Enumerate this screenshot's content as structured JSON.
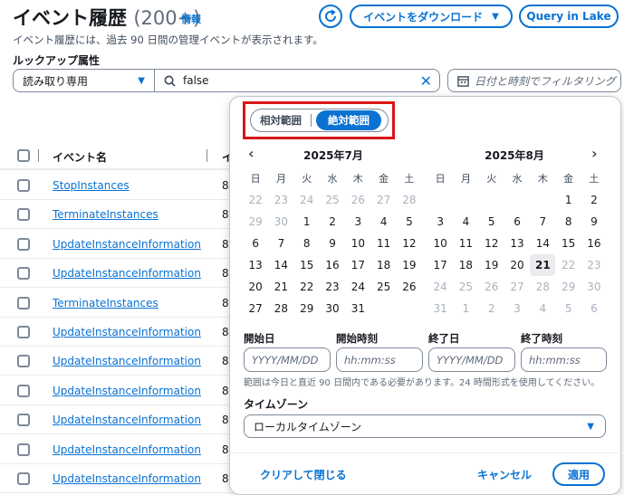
{
  "header": {
    "title": "イベント履歴",
    "count": "(200+)",
    "info_link": "情報",
    "download_label": "イベントをダウンロード",
    "query_label": "Query in Lake",
    "subtitle": "イベント履歴には、過去 90 日間の管理イベントが表示されます。"
  },
  "filter": {
    "lookup_label": "ルックアップ属性",
    "attribute_value": "読み取り専用",
    "search_value": "false",
    "date_placeholder": "日付と時刻でフィルタリング"
  },
  "table": {
    "header_name": "イベント名",
    "header_extra": "イ",
    "rows": [
      {
        "name": "StopInstances",
        "val": "8"
      },
      {
        "name": "TerminateInstances",
        "val": "8"
      },
      {
        "name": "UpdateInstanceInformation",
        "val": "8"
      },
      {
        "name": "UpdateInstanceInformation",
        "val": "8"
      },
      {
        "name": "TerminateInstances",
        "val": "8"
      },
      {
        "name": "UpdateInstanceInformation",
        "val": "8"
      },
      {
        "name": "UpdateInstanceInformation",
        "val": "8"
      },
      {
        "name": "UpdateInstanceInformation",
        "val": "8"
      },
      {
        "name": "UpdateInstanceInformation",
        "val": "8"
      },
      {
        "name": "UpdateInstanceInformation",
        "val": "8"
      },
      {
        "name": "UpdateInstanceInformation",
        "val": "8"
      }
    ]
  },
  "popover": {
    "relative_label": "相対範囲",
    "absolute_label": "絶対範囲",
    "weekdays": [
      "日",
      "月",
      "火",
      "水",
      "木",
      "金",
      "土"
    ],
    "left_month": {
      "title": "2025年7月",
      "days": [
        {
          "d": "22",
          "dim": true
        },
        {
          "d": "23",
          "dim": true
        },
        {
          "d": "24",
          "dim": true
        },
        {
          "d": "25",
          "dim": true
        },
        {
          "d": "26",
          "dim": true
        },
        {
          "d": "27",
          "dim": true
        },
        {
          "d": "28",
          "dim": true
        },
        {
          "d": "29",
          "dim": true
        },
        {
          "d": "30",
          "dim": true
        },
        {
          "d": "1"
        },
        {
          "d": "2"
        },
        {
          "d": "3"
        },
        {
          "d": "4"
        },
        {
          "d": "5"
        },
        {
          "d": "6"
        },
        {
          "d": "7"
        },
        {
          "d": "8"
        },
        {
          "d": "9"
        },
        {
          "d": "10"
        },
        {
          "d": "11"
        },
        {
          "d": "12"
        },
        {
          "d": "13"
        },
        {
          "d": "14"
        },
        {
          "d": "15"
        },
        {
          "d": "16"
        },
        {
          "d": "17"
        },
        {
          "d": "18"
        },
        {
          "d": "19"
        },
        {
          "d": "20"
        },
        {
          "d": "21"
        },
        {
          "d": "22"
        },
        {
          "d": "23"
        },
        {
          "d": "24"
        },
        {
          "d": "25"
        },
        {
          "d": "26"
        },
        {
          "d": "27"
        },
        {
          "d": "28"
        },
        {
          "d": "29"
        },
        {
          "d": "30"
        },
        {
          "d": "31"
        },
        {
          "d": ""
        },
        {
          "d": ""
        }
      ]
    },
    "right_month": {
      "title": "2025年8月",
      "days": [
        {
          "d": ""
        },
        {
          "d": ""
        },
        {
          "d": ""
        },
        {
          "d": ""
        },
        {
          "d": ""
        },
        {
          "d": "1"
        },
        {
          "d": "2"
        },
        {
          "d": "3"
        },
        {
          "d": "4"
        },
        {
          "d": "5"
        },
        {
          "d": "6"
        },
        {
          "d": "7"
        },
        {
          "d": "8"
        },
        {
          "d": "9"
        },
        {
          "d": "10"
        },
        {
          "d": "11"
        },
        {
          "d": "12"
        },
        {
          "d": "13"
        },
        {
          "d": "14"
        },
        {
          "d": "15"
        },
        {
          "d": "16"
        },
        {
          "d": "17"
        },
        {
          "d": "18"
        },
        {
          "d": "19"
        },
        {
          "d": "20"
        },
        {
          "d": "21",
          "today": true
        },
        {
          "d": "22",
          "dim": true
        },
        {
          "d": "23",
          "dim": true
        },
        {
          "d": "24",
          "dim": true
        },
        {
          "d": "25",
          "dim": true
        },
        {
          "d": "26",
          "dim": true
        },
        {
          "d": "27",
          "dim": true
        },
        {
          "d": "28",
          "dim": true
        },
        {
          "d": "29",
          "dim": true
        },
        {
          "d": "30",
          "dim": true
        },
        {
          "d": "31",
          "dim": true
        },
        {
          "d": "1",
          "dim": true
        },
        {
          "d": "2",
          "dim": true
        },
        {
          "d": "3",
          "dim": true
        },
        {
          "d": "4",
          "dim": true
        },
        {
          "d": "5",
          "dim": true
        },
        {
          "d": "6",
          "dim": true
        }
      ]
    },
    "start_date_label": "開始日",
    "start_time_label": "開始時刻",
    "end_date_label": "終了日",
    "end_time_label": "終了時刻",
    "date_placeholder": "YYYY/MM/DD",
    "time_placeholder": "hh:mm:ss",
    "hint": "範囲は今日と直近 90 日間内である必要があります。24 時間形式を使用してください。",
    "timezone_label": "タイムゾーン",
    "timezone_value": "ローカルタイムゾーン",
    "clear_label": "クリアして閉じる",
    "cancel_label": "キャンセル",
    "apply_label": "適用"
  },
  "colors": {
    "accent": "#0972d3",
    "highlight": "#d91515"
  }
}
